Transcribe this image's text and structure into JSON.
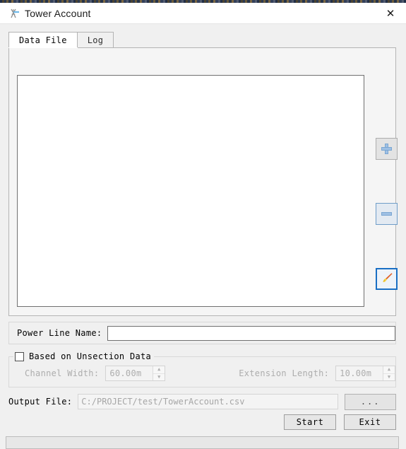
{
  "window": {
    "title": "Tower Account",
    "icon": "tower-icon",
    "close_label": "✕"
  },
  "tabs": [
    {
      "label": "Data File",
      "active": true
    },
    {
      "label": "Log",
      "active": false
    }
  ],
  "data_file_tab": {
    "file_list": {
      "items": [],
      "empty": true
    },
    "tools": [
      {
        "name": "add",
        "icon": "plus-icon",
        "state": "normal"
      },
      {
        "name": "remove",
        "icon": "minus-icon",
        "state": "highlighted"
      },
      {
        "name": "edit",
        "icon": "paintbrush-icon",
        "state": "focused"
      }
    ]
  },
  "power_line": {
    "label": "Power Line Name:",
    "value": "",
    "placeholder": ""
  },
  "unsection_group": {
    "checkbox_label": "Based on Unsection Data",
    "checked": false,
    "enabled": false,
    "channel_width": {
      "label": "Channel Width:",
      "value": "60.00m"
    },
    "extension_length": {
      "label": "Extension Length:",
      "value": "10.00m"
    }
  },
  "output": {
    "label": "Output File:",
    "value": "C:/PROJECT/test/TowerAccount.csv",
    "browse_label": "..."
  },
  "actions": {
    "start_label": "Start",
    "exit_label": "Exit"
  },
  "progress": {
    "percent": 0,
    "text": ""
  },
  "colors": {
    "accent": "#1a6fc4",
    "window_bg": "#f0f0f0",
    "panel_bg": "#f5f5f5",
    "field_bg": "#ffffff",
    "disabled_text": "#adadad"
  }
}
